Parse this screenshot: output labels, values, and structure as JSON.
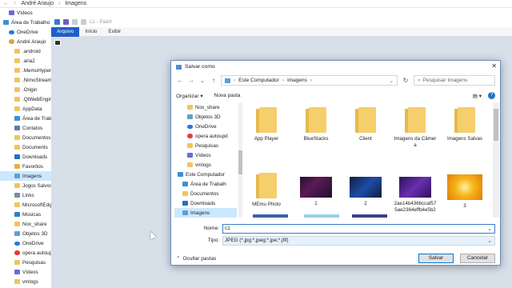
{
  "explorer": {
    "breadcrumb": [
      "André Araujo",
      "Imagens"
    ],
    "sidebar_items": [
      {
        "label": "Vídeos",
        "icon": "video-icon",
        "indent": 1
      },
      {
        "label": "Área de Trabalho",
        "icon": "desktop-icon",
        "indent": 0
      },
      {
        "label": "OneDrive",
        "icon": "onedrive-icon",
        "indent": 1
      },
      {
        "label": "André Araujo",
        "icon": "user-icon",
        "indent": 1
      },
      {
        "label": ".android",
        "icon": "folder-icon",
        "indent": 2
      },
      {
        "label": ".aria2",
        "icon": "folder-icon",
        "indent": 2
      },
      {
        "label": ".MemuHyperv",
        "icon": "folder-icon",
        "indent": 2
      },
      {
        "label": ".NimoStream",
        "icon": "folder-icon",
        "indent": 2
      },
      {
        "label": ".Origin",
        "icon": "folder-icon",
        "indent": 2
      },
      {
        "label": ".QtWebEngine",
        "icon": "folder-icon",
        "indent": 2
      },
      {
        "label": "AppData",
        "icon": "folder-icon",
        "indent": 2
      },
      {
        "label": "Área de Trabal",
        "icon": "desktop-icon",
        "indent": 2
      },
      {
        "label": "Contatos",
        "icon": "contacts-icon",
        "indent": 2
      },
      {
        "label": "Documentos",
        "icon": "folder-icon",
        "indent": 2
      },
      {
        "label": "Documents",
        "icon": "folder-icon",
        "indent": 2
      },
      {
        "label": "Downloads",
        "icon": "download-icon",
        "indent": 2
      },
      {
        "label": "Favoritos",
        "icon": "star-icon",
        "indent": 2
      },
      {
        "label": "Imagens",
        "icon": "pictures-icon",
        "indent": 2,
        "selected": true
      },
      {
        "label": "Jogos Salvos",
        "icon": "folder-icon",
        "indent": 2
      },
      {
        "label": "Links",
        "icon": "link-icon",
        "indent": 2
      },
      {
        "label": "MicrosoftEdge",
        "icon": "folder-icon",
        "indent": 2
      },
      {
        "label": "Músicas",
        "icon": "music-icon",
        "indent": 2
      },
      {
        "label": "Nox_share",
        "icon": "folder-icon",
        "indent": 2
      },
      {
        "label": "Objetos 3D",
        "icon": "3d-objects-icon",
        "indent": 2
      },
      {
        "label": "OneDrive",
        "icon": "onedrive-icon",
        "indent": 2
      },
      {
        "label": "opera autoupd",
        "icon": "opera-icon",
        "indent": 2
      },
      {
        "label": "Pesquisas",
        "icon": "folder-icon",
        "indent": 2
      },
      {
        "label": "Vídeos",
        "icon": "video-icon",
        "indent": 2
      },
      {
        "label": "vmlogs",
        "icon": "folder-icon",
        "indent": 2
      }
    ]
  },
  "paint": {
    "title": "c1 - Paint",
    "ribbon_tabs": [
      "Arquivo",
      "Início",
      "Exibir"
    ]
  },
  "dialog": {
    "title": "Salvar como",
    "address": [
      "Este Computador",
      "Imagens"
    ],
    "search_placeholder": "Pesquisar Imagens",
    "toolbar": {
      "organize": "Organizar",
      "new_folder": "Nova pasta"
    },
    "nav_items": [
      {
        "label": "Nox_share",
        "icon": "folder-icon",
        "indent": 2
      },
      {
        "label": "Objetos 3D",
        "icon": "3d-objects-icon",
        "indent": 2
      },
      {
        "label": "OneDrive",
        "icon": "onedrive-icon",
        "indent": 2
      },
      {
        "label": "opera autoupd",
        "icon": "opera-icon",
        "indent": 2
      },
      {
        "label": "Pesquisas",
        "icon": "folder-icon",
        "indent": 2
      },
      {
        "label": "Vídeos",
        "icon": "video-icon",
        "indent": 2
      },
      {
        "label": "vmlogs",
        "icon": "folder-icon",
        "indent": 2
      },
      {
        "label": "Este Computador",
        "icon": "computer-icon",
        "indent": 0
      },
      {
        "label": "Área de Trabalh",
        "icon": "desktop-icon",
        "indent": 1
      },
      {
        "label": "Documentos",
        "icon": "folder-icon",
        "indent": 1
      },
      {
        "label": "Downloads",
        "icon": "download-icon",
        "indent": 1
      },
      {
        "label": "Imagens",
        "icon": "pictures-icon",
        "indent": 1,
        "selected": true
      }
    ],
    "files": [
      {
        "label": "App Player",
        "kind": "folder"
      },
      {
        "label": "BlueStacks",
        "kind": "folder"
      },
      {
        "label": "Client",
        "kind": "folder"
      },
      {
        "label": "Imagens da Câmera",
        "kind": "folder"
      },
      {
        "label": "Imagens Salvas",
        "kind": "folder"
      },
      {
        "label": "MEmu Photo",
        "kind": "folder"
      },
      {
        "label": "1",
        "kind": "image",
        "thumb": "thumb-1"
      },
      {
        "label": "2",
        "kind": "image",
        "thumb": "thumb-2"
      },
      {
        "label": "2ae14b436bccaf575ae2364effb4e5b2",
        "kind": "image",
        "thumb": "thumb-3"
      },
      {
        "label": "3",
        "kind": "image",
        "thumb": "thumb-4"
      }
    ],
    "name_label": "Nome:",
    "name_value": "c1",
    "type_label": "Tipo:",
    "type_value": "JPEG (*.jpg;*.jpeg;*.jpe;*.jfif)",
    "hide_folders": "Ocultar pastas",
    "save": "Salvar",
    "cancel": "Cancelar"
  }
}
